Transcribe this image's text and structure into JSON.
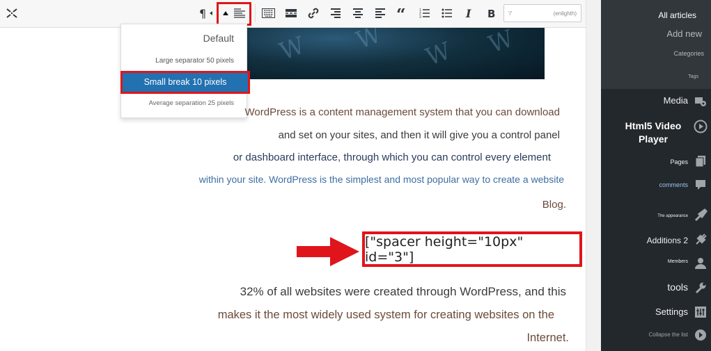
{
  "toolbar": {
    "search_placeholder": "(enlighth)",
    "search_prefix": "'/'",
    "buttons": [
      "fullscreen-icon",
      "paragraph-icon",
      "spacer-icon",
      "keyboard-icon",
      "more-tag-icon",
      "link-icon",
      "align-right-icon",
      "align-center-icon",
      "align-left-icon",
      "blockquote-icon",
      "numbered-list-icon",
      "bulleted-list-icon",
      "italic-icon",
      "bold-icon"
    ]
  },
  "dropdown": {
    "items": [
      {
        "label": "Default"
      },
      {
        "label": "Large separator 50 pixels"
      },
      {
        "label": "Small break 10 pixels"
      },
      {
        "label": "Average separation 25 pixels"
      }
    ],
    "selected_index": 2
  },
  "content": {
    "paragraph1": [
      "WordPress is a content management system that you can download",
      "and set on your sites, and then it will give you a control panel",
      "or dashboard interface, through which you can control every element",
      "within your site. WordPress is the simplest and most popular way to create a website",
      "Blog."
    ],
    "shortcode": "[\"spacer height=\"10px\" id=\"3\"]",
    "paragraph2": [
      "32% of all websites were created through WordPress, and this",
      "makes it the most widely used system for creating websites on the",
      "Internet."
    ]
  },
  "sidebar": {
    "posts_submenu": [
      "All articles",
      "Add new",
      "Categories",
      "Tags"
    ],
    "menu": [
      {
        "label": "Media",
        "icon": "media-icon"
      },
      {
        "label": "Html5 Video Player",
        "icon": "play-icon"
      },
      {
        "label": "Pages",
        "icon": "pages-icon"
      },
      {
        "label": "comments",
        "icon": "comments-icon"
      },
      {
        "label": "The appearance",
        "icon": "appearance-icon"
      },
      {
        "label": "Additions 2",
        "icon": "plugins-icon"
      },
      {
        "label": "Members",
        "icon": "users-icon"
      },
      {
        "label": "tools",
        "icon": "tools-icon"
      },
      {
        "label": "Settings",
        "icon": "settings-icon"
      },
      {
        "label": "Collapse the list",
        "icon": "collapse-icon"
      }
    ]
  },
  "colors": {
    "highlight": "#e0151b",
    "selected": "#2271b1",
    "sidebar_bg": "#23282d",
    "submenu_bg": "#32373c"
  }
}
